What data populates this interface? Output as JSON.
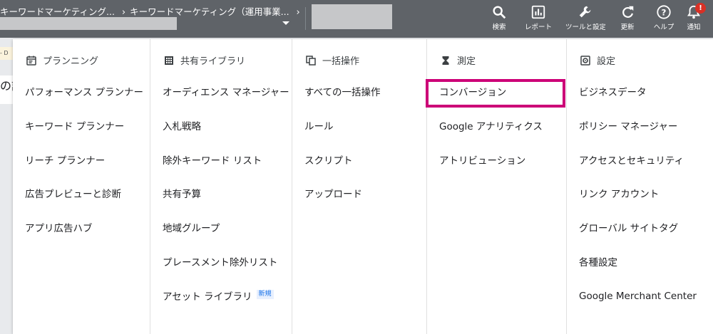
{
  "breadcrumb": {
    "items": [
      "キーワードマーケティング...",
      "キーワードマーケティング（運用事業..."
    ]
  },
  "toolbar": {
    "search_label": "検索",
    "reports_label": "レポート",
    "tools_label": "ツールと設定",
    "refresh_label": "更新",
    "help_label": "ヘルプ",
    "notifications_label": "通知",
    "notification_badge": "!"
  },
  "underlay": {
    "chip_text": "- D",
    "title_fragment": "の設"
  },
  "columns": [
    {
      "title": "プランニング",
      "icon": "calendar-icon",
      "items": [
        "パフォーマンス プランナー",
        "キーワード プランナー",
        "リーチ プランナー",
        "広告プレビューと診断",
        "アプリ広告ハブ"
      ]
    },
    {
      "title": "共有ライブラリ",
      "icon": "grid-icon",
      "items": [
        "オーディエンス マネージャー",
        "入札戦略",
        "除外キーワード リスト",
        "共有予算",
        "地域グループ",
        "プレースメント除外リスト",
        "アセット ライブラリ"
      ],
      "new_badge": "新規"
    },
    {
      "title": "一括操作",
      "icon": "copy-icon",
      "items": [
        "すべての一括操作",
        "ルール",
        "スクリプト",
        "アップロード"
      ]
    },
    {
      "title": "測定",
      "icon": "hourglass-icon",
      "items": [
        "コンバージョン",
        "Google アナリティクス",
        "アトリビューション"
      ]
    },
    {
      "title": "設定",
      "icon": "settings-icon",
      "items": [
        "ビジネスデータ",
        "ポリシー マネージャー",
        "アクセスとセキュリティ",
        "リンク アカウント",
        "グローバル サイトタグ",
        "各種設定",
        "Google Merchant Center"
      ]
    }
  ],
  "colors": {
    "topbar": "#5f6368",
    "highlight": "#cc0077",
    "badge": "#d93025"
  }
}
